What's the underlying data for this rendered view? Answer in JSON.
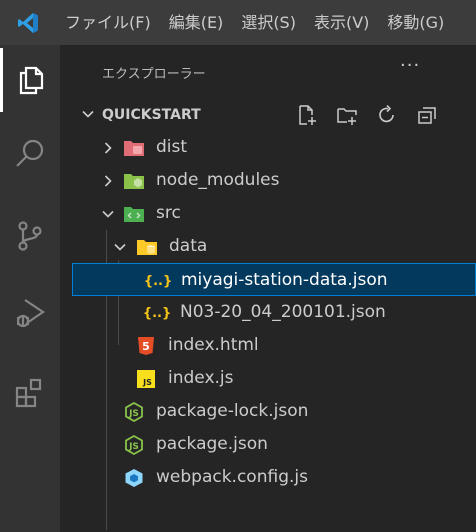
{
  "titlebar": {
    "menu": [
      "ファイル(F)",
      "編集(E)",
      "選択(S)",
      "表示(V)",
      "移動(G)"
    ]
  },
  "activity_bar": {
    "items": [
      "explorer-icon",
      "search-icon",
      "source-control-icon",
      "run-debug-icon",
      "extensions-icon"
    ]
  },
  "sidebar": {
    "title": "エクスプローラー",
    "more": "···",
    "section_title": "QUICKSTART",
    "tree": [
      {
        "label": "dist",
        "type": "folder",
        "icon": "folder-dist-icon",
        "color": "#e06c75"
      },
      {
        "label": "node_modules",
        "type": "folder",
        "icon": "folder-node-icon",
        "color": "#8bc34a"
      },
      {
        "label": "src",
        "type": "folder",
        "icon": "folder-src-icon",
        "color": "#4caf50"
      },
      {
        "label": "data",
        "type": "folder",
        "icon": "folder-data-icon",
        "color": "#ffca28"
      },
      {
        "label": "miyagi-station-data.json",
        "type": "file",
        "icon": "json-icon",
        "color": "#f5c518"
      },
      {
        "label": "N03-20_04_200101.json",
        "type": "file",
        "icon": "json-icon",
        "color": "#f5c518"
      },
      {
        "label": "index.html",
        "type": "file",
        "icon": "html5-icon",
        "color": "#e44d26"
      },
      {
        "label": "index.js",
        "type": "file",
        "icon": "javascript-icon",
        "color": "#f7df1e"
      },
      {
        "label": "package-lock.json",
        "type": "file",
        "icon": "nodejs-icon",
        "color": "#8bc34a"
      },
      {
        "label": "package.json",
        "type": "file",
        "icon": "nodejs-icon",
        "color": "#8bc34a"
      },
      {
        "label": "webpack.config.js",
        "type": "file",
        "icon": "webpack-icon",
        "color": "#8ed6fb"
      }
    ],
    "icon_text": {
      "html": "5",
      "js": "JS",
      "json": "{..}"
    }
  }
}
